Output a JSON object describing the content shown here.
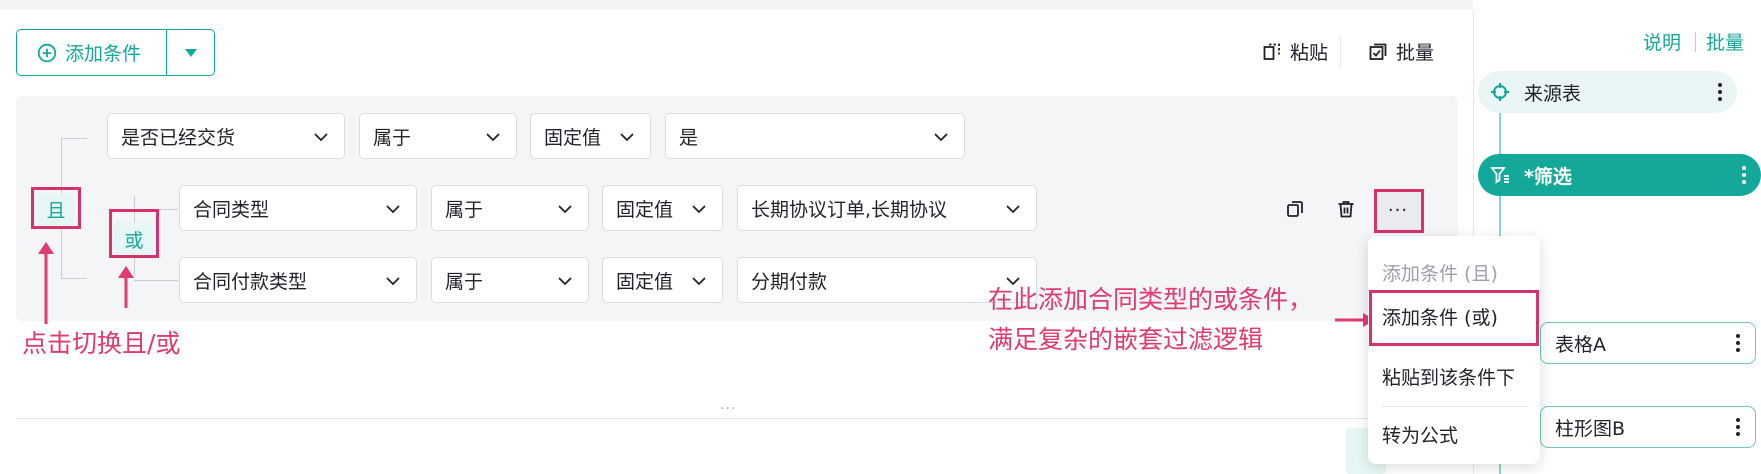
{
  "toolbar": {
    "add_condition": "添加条件",
    "paste": "粘贴",
    "batch": "批量"
  },
  "logic": {
    "and_label": "且",
    "or_label": "或"
  },
  "conditions": {
    "row1": {
      "field": "是否已经交货",
      "operator": "属于",
      "value_type": "固定值",
      "value": "是"
    },
    "row2": {
      "field": "合同类型",
      "operator": "属于",
      "value_type": "固定值",
      "value": "长期协议订单,长期协议"
    },
    "row3": {
      "field": "合同付款类型",
      "operator": "属于",
      "value_type": "固定值",
      "value": "分期付款"
    }
  },
  "row_actions": {
    "more": "···"
  },
  "menu": {
    "add_and": "添加条件 (且)",
    "add_or": "添加条件 (或)",
    "paste_below": "粘贴到该条件下",
    "to_formula": "转为公式"
  },
  "annotations": {
    "toggle_hint": "点击切换且/或",
    "nested_hint_line1": "在此添加合同类型的或条件，",
    "nested_hint_line2": "满足复杂的嵌套过滤逻辑"
  },
  "divider_handle": "...",
  "right_panel": {
    "explain": "说明",
    "batch": "批量",
    "nodes": {
      "source": "来源表",
      "filter": "*筛选",
      "table_a": "表格A",
      "chart_b": "柱形图B"
    }
  },
  "colors": {
    "accent": "#14a89b",
    "highlight": "#d6336c",
    "annotation": "#e03a6e"
  }
}
